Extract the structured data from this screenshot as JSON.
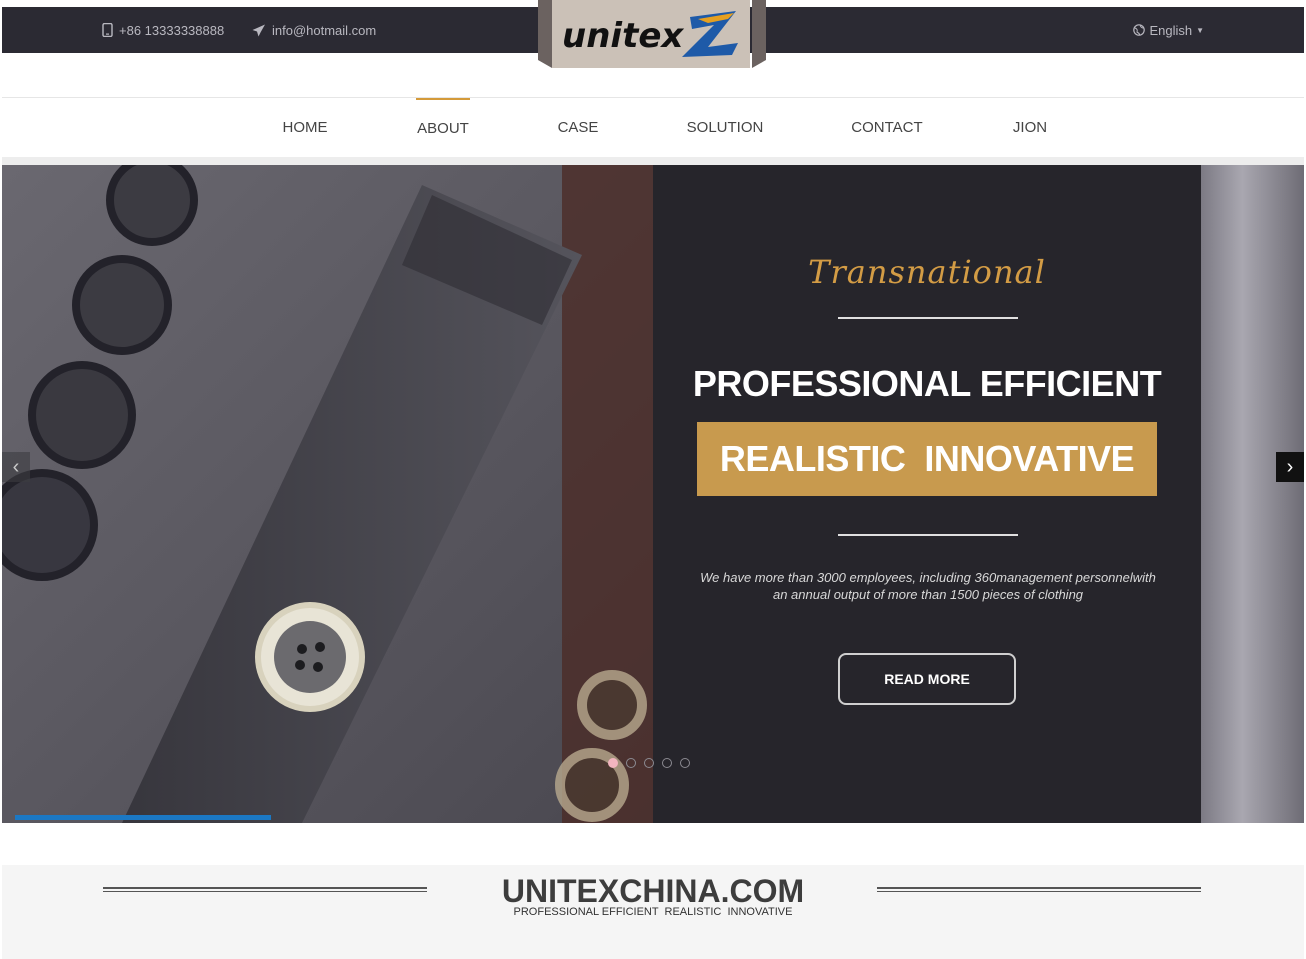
{
  "topbar": {
    "phone": "+86 13333338888",
    "email": "info@hotmail.com",
    "language": "English"
  },
  "logo": {
    "text": "unitex"
  },
  "nav": {
    "items": [
      {
        "label": "HOME"
      },
      {
        "label": "ABOUT"
      },
      {
        "label": "CASE"
      },
      {
        "label": "SOLUTION"
      },
      {
        "label": "CONTACT"
      },
      {
        "label": "JION"
      }
    ],
    "active": "ABOUT"
  },
  "slide": {
    "script_title": "Transnational",
    "headline": "PROFESSIONAL EFFICIENT",
    "highlight": "REALISTIC  INNOVATIVE",
    "description_line1": "We have more than 3000 employees, including 360management personnelwith",
    "description_line2": "an annual output of more than 1500 pieces of clothing",
    "button": "READ MORE",
    "dot_count": 5,
    "active_dot": 1
  },
  "brand": {
    "title": "UNITEXCHINA.COM",
    "subtitle": "PROFESSIONAL EFFICIENT  REALISTIC  INNOVATIVE"
  },
  "colors": {
    "topbar": "#2b2a33",
    "accent_gold": "#c89a4e",
    "nav_active": "#d49a3a",
    "progress_blue": "#1b78c4"
  },
  "icons": {
    "phone": "phone-icon",
    "email": "paper-plane-icon",
    "language": "globe-icon",
    "prev": "chevron-left-icon",
    "next": "chevron-right-icon"
  }
}
